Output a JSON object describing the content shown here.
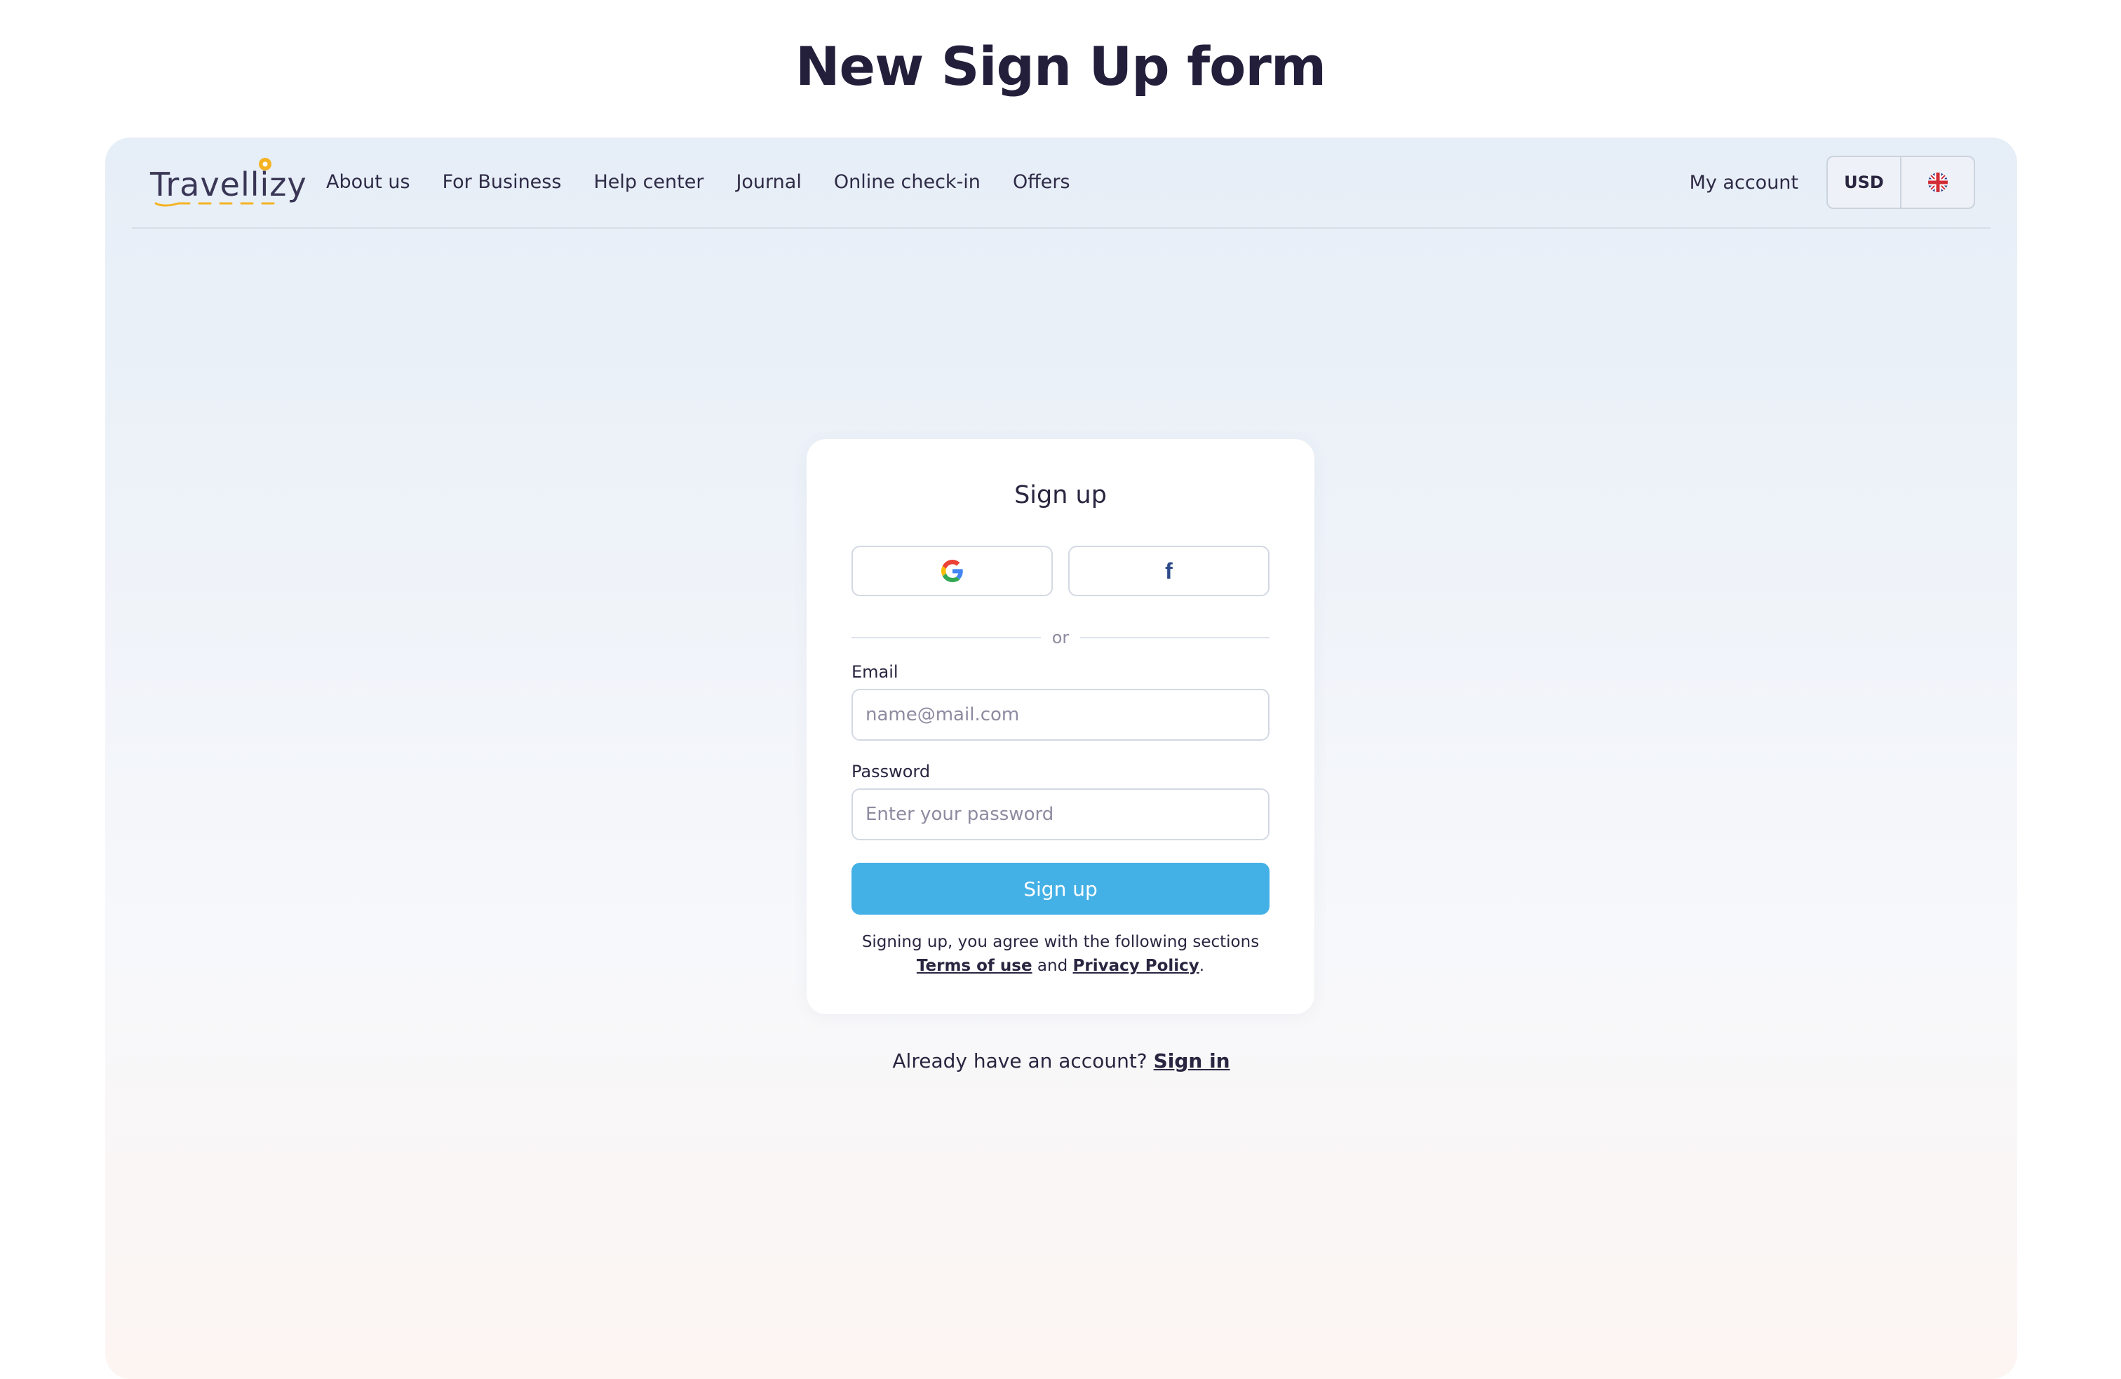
{
  "page_heading": "New Sign Up form",
  "brand": {
    "logo_text": "Travellizy",
    "accent_color": "#f5b324",
    "primary_color": "#44b1e6"
  },
  "nav": {
    "links": [
      "About us",
      "For Business",
      "Help center",
      "Journal",
      "Online check-in",
      "Offers"
    ],
    "my_account": "My account",
    "currency": "USD",
    "language_icon": "uk-flag-icon"
  },
  "signup_card": {
    "title": "Sign up",
    "google_icon": "google-icon",
    "facebook_icon": "facebook-icon",
    "divider_text": "or",
    "email_label": "Email",
    "email_placeholder": "name@mail.com",
    "password_label": "Password",
    "password_placeholder": "Enter your password",
    "submit_label": "Sign up",
    "legal_prefix": "Signing up, you agree with the following sections",
    "terms_link": "Terms of use",
    "legal_and": "and",
    "privacy_link": "Privacy Policy",
    "legal_suffix": "."
  },
  "footer": {
    "prompt": "Already have an account?",
    "signin_link": "Sign in"
  }
}
